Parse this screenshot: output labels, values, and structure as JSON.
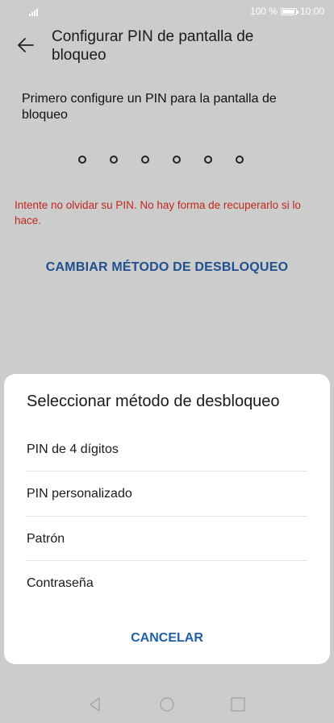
{
  "status": {
    "battery": "100 %",
    "time": "10:00"
  },
  "header": {
    "title": "Configurar PIN de pantalla de bloqueo"
  },
  "main": {
    "instruction": "Primero configure un PIN para la pantalla de bloqueo",
    "pin_dots": 6,
    "warning": "Intente no olvidar su PIN. No hay forma de recuperarlo si lo hace.",
    "change_method": "CAMBIAR MÉTODO DE DESBLOQUEO"
  },
  "sheet": {
    "title": "Seleccionar método de desbloqueo",
    "options": [
      "PIN de 4 dígitos",
      "PIN personalizado",
      "Patrón",
      "Contraseña"
    ],
    "cancel": "CANCELAR"
  },
  "colors": {
    "warning": "#c0281c",
    "accent": "#1f4f8f",
    "dim_background": "#cccccc"
  }
}
